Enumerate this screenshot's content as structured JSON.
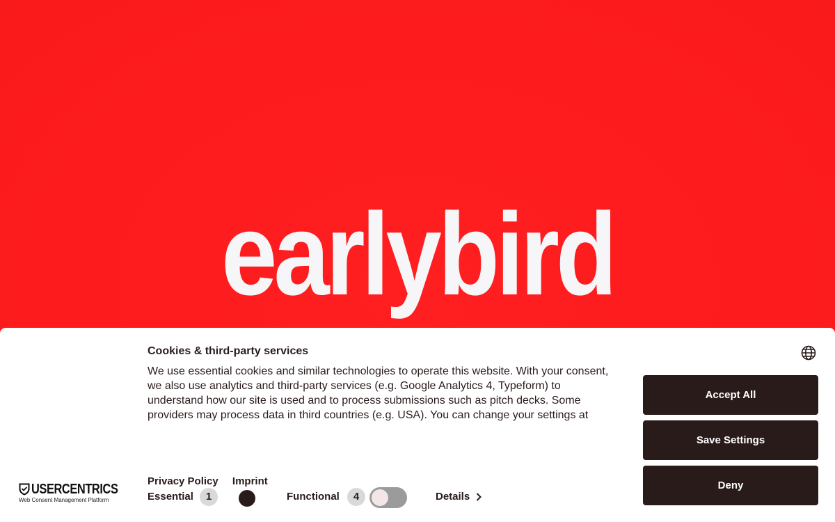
{
  "hero": {
    "logo_text": "earlybird"
  },
  "consent": {
    "title": "Cookies & third-party services",
    "description": "We use essential cookies and similar technologies to operate this website. With your consent, we also use analytics and third-party services (e.g. Google Analytics 4, Typeform) to understand how our site is used and to process submissions such as pitch decks. Some providers may process data in third countries (e.g. USA). You can change your settings at",
    "buttons": {
      "accept_all": "Accept All",
      "save_settings": "Save Settings",
      "deny": "Deny"
    },
    "links": {
      "privacy_policy": "Privacy Policy",
      "imprint": "Imprint"
    },
    "categories": [
      {
        "label": "Essential",
        "count": "1",
        "enabled": true,
        "locked": true
      },
      {
        "label": "Functional",
        "count": "4",
        "enabled": false
      }
    ],
    "details_label": "Details",
    "language_icon": "globe-icon",
    "branding": {
      "name": "USERCENTRICS",
      "tagline": "Web Consent Management Platform"
    }
  },
  "colors": {
    "hero_bg": "#fe1b1d",
    "logo_text": "#f6f6f8",
    "button_bg": "#2a1b1b",
    "text": "#2a1b1b",
    "toggle_off": "#9b9b9b"
  }
}
